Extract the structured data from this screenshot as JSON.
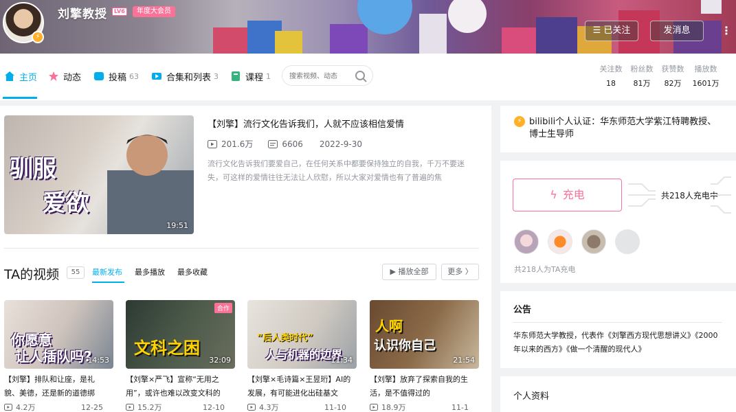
{
  "header": {
    "username": "刘擎教授",
    "level": "LV6",
    "vip_badge": "年度大会员",
    "follow_button": "☰ 已关注",
    "message_button": "发消息",
    "more_icon": "vertical-ellipsis-icon"
  },
  "nav": {
    "tabs": [
      {
        "label": "主页",
        "count": "",
        "icon": "home-icon"
      },
      {
        "label": "动态",
        "count": "",
        "icon": "dynamic-icon"
      },
      {
        "label": "投稿",
        "count": "63",
        "icon": "upload-icon"
      },
      {
        "label": "合集和列表",
        "count": "3",
        "icon": "collection-icon"
      },
      {
        "label": "课程",
        "count": "1",
        "icon": "course-icon"
      }
    ],
    "search_placeholder": "搜索视频、动态",
    "stats": [
      {
        "label": "关注数",
        "value": "18"
      },
      {
        "label": "粉丝数",
        "value": "81万"
      },
      {
        "label": "获赞数",
        "value": "82万"
      },
      {
        "label": "播放数",
        "value": "1601万"
      }
    ]
  },
  "featured": {
    "thumb_caption_1": "驯服",
    "thumb_caption_2": "爱欲",
    "duration": "19:51",
    "title": "【刘擎】流行文化告诉我们，人就不应该相信爱情",
    "plays": "201.6万",
    "comments": "6606",
    "date": "2022-9-30",
    "description": "流行文化告诉我们要爱自己，在任何关系中都要保持独立的自我，千万不要迷失，可这样的爱情往往无法让人欣慰，所以大家对爱情也有了普遍的焦"
  },
  "videos_section": {
    "title": "TA的视频",
    "count": "55",
    "tabs": [
      "最新发布",
      "最多播放",
      "最多收藏"
    ],
    "play_all": "▶ 播放全部",
    "more": "更多 〉"
  },
  "videos": [
    {
      "caption1": "你愿意",
      "caption2": "让人插队吗?",
      "duration": "14:53",
      "title": "【刘擎】排队和让座，是礼貌、美德，还是新的道德绑",
      "plays": "4.2万",
      "date": "12-25",
      "badge": ""
    },
    {
      "caption1": "文科之困",
      "caption2": "",
      "duration": "32:09",
      "title": "【刘擎×严飞】宣称“无用之用”，或许也难以改变文科的",
      "plays": "15.2万",
      "date": "12-10",
      "badge": "合作"
    },
    {
      "caption1": "“后人类时代”",
      "caption2": "人与机器的边界",
      "duration": "11:34",
      "title": "【刘擎×毛诗篇×王昱珩】AI的发展，有可能进化出硅基文",
      "plays": "4.3万",
      "date": "11-10",
      "badge": ""
    },
    {
      "caption1": "人啊",
      "caption2": "认识你自己",
      "duration": "21:54",
      "title": "【刘擎】放弃了探索自我的生活，是不值得过的",
      "plays": "18.9万",
      "date": "11-1",
      "badge": ""
    }
  ],
  "sidebar": {
    "auth_text": "bilibili个人认证：华东师范大学紫江特聘教授、博士生导师",
    "charge_button": "充电",
    "charge_count": "共218人充电中",
    "charge_footer": "共218人为TA充电",
    "notice_title": "公告",
    "notice_text": "华东师范大学教授，代表作《刘擎西方现代思想讲义》《2000年以来的西方》《做一个清醒的现代人》",
    "profile_title": "个人资料"
  },
  "colors": {
    "accent": "#00aeec",
    "pink": "#fb7299",
    "gold": "#ffb027"
  }
}
